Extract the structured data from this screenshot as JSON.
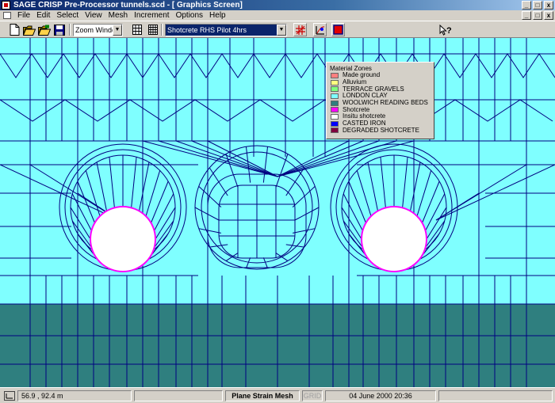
{
  "window": {
    "title": "SAGE CRISP Pre-Processor tunnels.scd - [ Graphics Screen]",
    "controls": {
      "minimize": "_",
      "maximize": "□",
      "close": "x"
    }
  },
  "menubar": {
    "items": [
      "File",
      "Edit",
      "Select",
      "View",
      "Mesh",
      "Increment",
      "Options",
      "Help"
    ]
  },
  "toolbar": {
    "zoom_select": "Zoom Window",
    "stage_select": "Shotcrete RHS Pilot 4hrs",
    "icons": [
      "new-file-icon",
      "open-folder-icon",
      "open-drawing-icon",
      "save-icon",
      "grid-icon",
      "table-icon",
      "mesh-tool-icon",
      "axes-tool-icon",
      "color-tool-icon",
      "context-help-icon"
    ]
  },
  "legend": {
    "title": "Material Zones",
    "items": [
      {
        "label": "Made ground",
        "color": "#ff7f7f"
      },
      {
        "label": "Alluvium",
        "color": "#ffff7f"
      },
      {
        "label": "TERRACE GRAVELS",
        "color": "#7fff7f"
      },
      {
        "label": "LONDON CLAY",
        "color": "#7fffff"
      },
      {
        "label": "WOOLWICH  READING BEDS",
        "color": "#2f7f7f"
      },
      {
        "label": "Shotcrete",
        "color": "#ff00ff"
      },
      {
        "label": "Insitu shotcrete",
        "color": "#ffffff"
      },
      {
        "label": "CASTED IRON",
        "color": "#0000ff"
      },
      {
        "label": "DEGRADED SHOTCRETE",
        "color": "#7f003f"
      }
    ]
  },
  "colors": {
    "london_clay": "#7fffff",
    "woolwich_reading_beds": "#2f7f7f",
    "mesh_lines": "#000080",
    "shotcrete": "#ff00ff",
    "excavated": "#ffffff"
  },
  "statusbar": {
    "coordinates": "56.9 , 92.4 m",
    "mode": "Plane Strain Mesh",
    "grid": "GRID",
    "datetime": "04 June 2000 20:36"
  }
}
